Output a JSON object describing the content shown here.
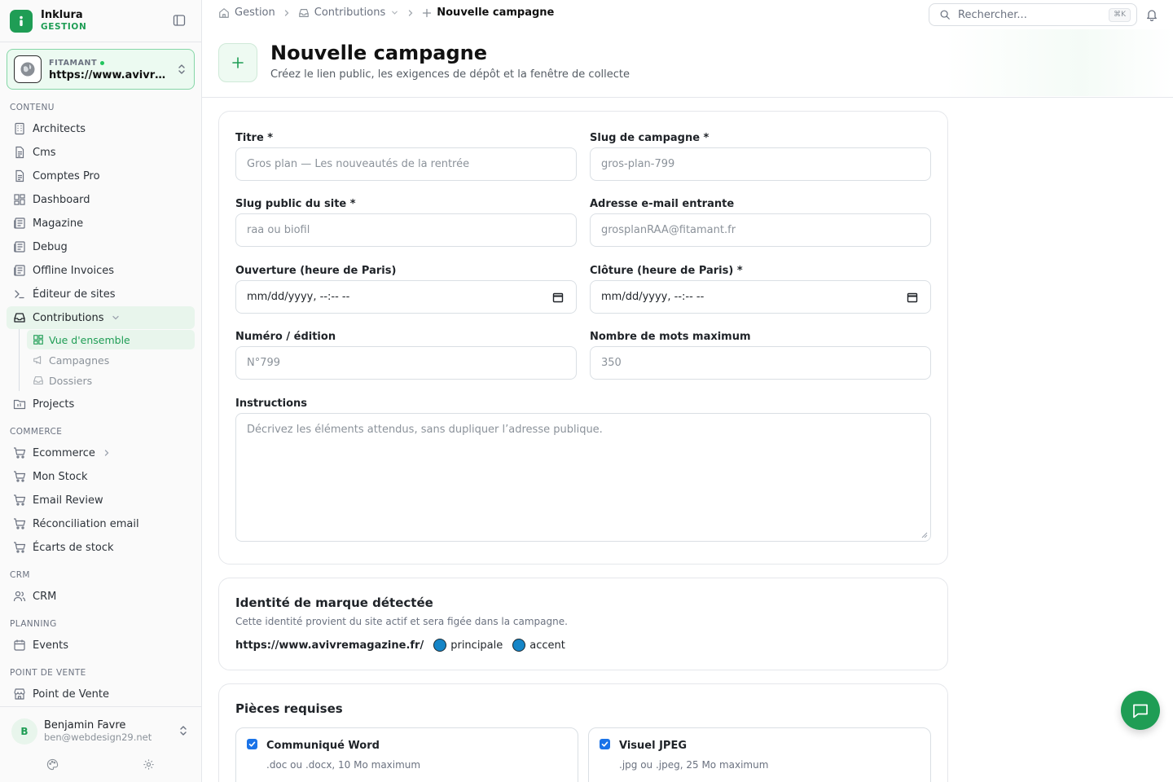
{
  "app": {
    "name": "Inklura",
    "subtitle": "GESTION",
    "accent": "#1f9d55"
  },
  "site_switcher": {
    "label": "FITAMANT",
    "url": "https://www.avivremagazine.fr/"
  },
  "sidebar": {
    "sections": {
      "content": "CONTENU",
      "commerce": "COMMERCE",
      "crm": "CRM",
      "planning": "PLANNING",
      "pos": "POINT DE VENTE"
    },
    "content_items": [
      {
        "label": "Architects",
        "icon": "building-icon"
      },
      {
        "label": "Cms",
        "icon": "file-icon"
      },
      {
        "label": "Comptes Pro",
        "icon": "file-icon"
      },
      {
        "label": "Dashboard",
        "icon": "dashboard-icon"
      },
      {
        "label": "Magazine",
        "icon": "newspaper-icon"
      },
      {
        "label": "Debug",
        "icon": "newspaper-icon"
      },
      {
        "label": "Offline Invoices",
        "icon": "newspaper-icon"
      },
      {
        "label": "Éditeur de sites",
        "icon": "terminal-icon"
      },
      {
        "label": "Contributions",
        "icon": "inbox-icon"
      }
    ],
    "contributions_sub": [
      {
        "label": "Vue d'ensemble",
        "icon": "dashboard-icon"
      },
      {
        "label": "Campagnes",
        "icon": "megaphone-icon"
      },
      {
        "label": "Dossiers",
        "icon": "inbox-icon"
      }
    ],
    "projects": "Projects",
    "commerce_items": [
      "Ecommerce",
      "Mon Stock",
      "Email Review",
      "Réconciliation email",
      "Écarts de stock"
    ],
    "crm_item": "CRM",
    "planning_item": "Events",
    "pos_item": "Point de Vente"
  },
  "user": {
    "initial": "B",
    "name": "Benjamin Favre",
    "email": "ben@webdesign29.net"
  },
  "breadcrumb": {
    "root": "Gestion",
    "section": "Contributions",
    "current": "Nouvelle campagne"
  },
  "search": {
    "placeholder": "Rechercher...",
    "shortcut": "⌘K"
  },
  "page": {
    "title": "Nouvelle campagne",
    "subtitle": "Créez le lien public, les exigences de dépôt et la fenêtre de collecte"
  },
  "form": {
    "title": {
      "label": "Titre *",
      "placeholder": "Gros plan — Les nouveautés de la rentrée"
    },
    "campaign_slug": {
      "label": "Slug de campagne *",
      "placeholder": "gros-plan-799"
    },
    "site_slug": {
      "label": "Slug public du site *",
      "placeholder": "raa ou biofil"
    },
    "inbound_email": {
      "label": "Adresse e-mail entrante",
      "placeholder": "grosplanRAA@fitamant.fr"
    },
    "opening": {
      "label": "Ouverture (heure de Paris)",
      "value": "mm/dd/yyyy, --:-- --"
    },
    "closing": {
      "label": "Clôture (heure de Paris) *",
      "value": "mm/dd/yyyy, --:-- --"
    },
    "issue": {
      "label": "Numéro / édition",
      "placeholder": "N°799"
    },
    "max_words": {
      "label": "Nombre de mots maximum",
      "placeholder": "350"
    },
    "instructions": {
      "label": "Instructions",
      "placeholder": "Décrivez les éléments attendus, sans dupliquer l’adresse publique."
    }
  },
  "brand_identity": {
    "title": "Identité de marque détectée",
    "description": "Cette identité provient du site actif et sera figée dans la campagne.",
    "url": "https://www.avivremagazine.fr/",
    "colors": [
      {
        "label": "principale",
        "hex": "#1585c7"
      },
      {
        "label": "accent",
        "hex": "#1585c7"
      }
    ]
  },
  "required_pieces": {
    "title": "Pièces requises",
    "items": [
      {
        "title": "Communiqué Word",
        "description": ".doc ou .docx, 10 Mo maximum",
        "checked": true
      },
      {
        "title": "Visuel JPEG",
        "description": ".jpg ou .jpeg, 25 Mo maximum",
        "checked": true
      }
    ]
  }
}
